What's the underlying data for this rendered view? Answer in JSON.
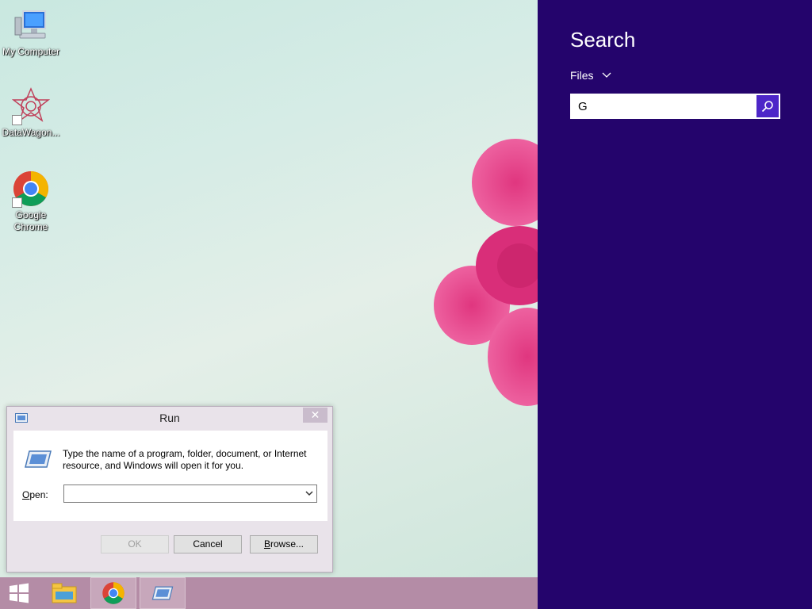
{
  "desktop": {
    "icons": [
      {
        "label": "My Computer"
      },
      {
        "label": "DataWagon..."
      },
      {
        "label": "Google Chrome"
      }
    ]
  },
  "run_dialog": {
    "title": "Run",
    "close_symbol": "✕",
    "description": "Type the name of a program, folder, document, or Internet resource, and Windows will open it for you.",
    "open_label_access": "O",
    "open_label_rest": "pen:",
    "open_value": "",
    "ok_label": "OK",
    "cancel_label": "Cancel",
    "browse_access": "B",
    "browse_rest": "rowse..."
  },
  "taskbar": {
    "items": [
      {
        "icon": "windows-start-icon"
      },
      {
        "icon": "file-explorer-icon"
      },
      {
        "icon": "chrome-icon"
      },
      {
        "icon": "run-icon"
      }
    ]
  },
  "search_charm": {
    "title": "Search",
    "scope": "Files",
    "query": "G",
    "background_color": "#24046c",
    "button_color": "#4d26c8"
  }
}
